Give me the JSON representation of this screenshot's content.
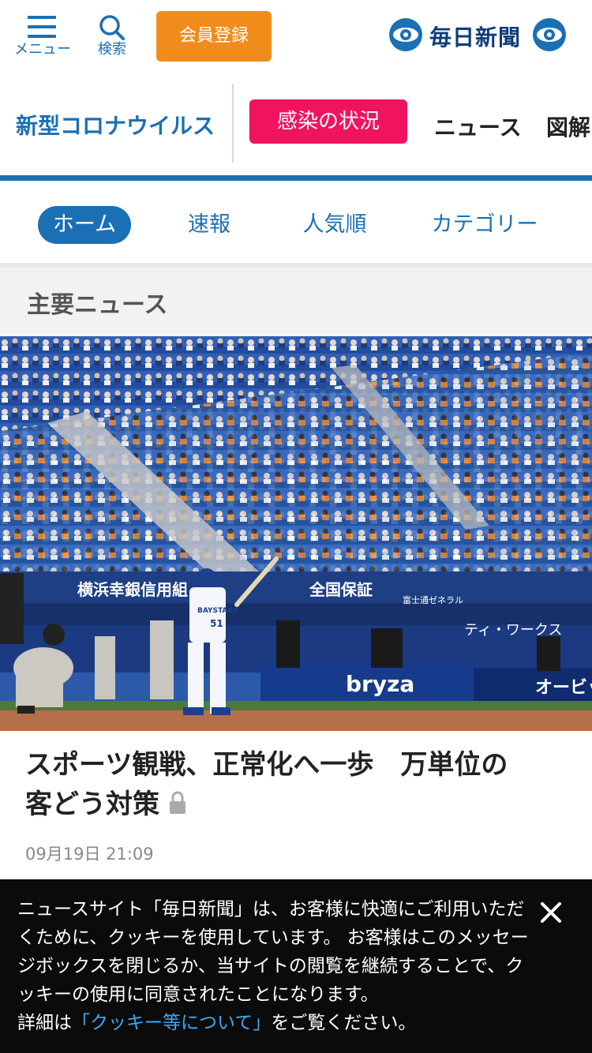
{
  "header": {
    "menu_label": "メニュー",
    "search_label": "検索",
    "register_label": "会員登録",
    "logo_text": "毎日新聞"
  },
  "corona": {
    "title": "新型コロナウイルス",
    "status_button": "感染の状況",
    "links": [
      "ニュース",
      "図解"
    ]
  },
  "tabs": [
    {
      "label": "ホーム",
      "active": true
    },
    {
      "label": "速報",
      "active": false
    },
    {
      "label": "人気順",
      "active": false
    },
    {
      "label": "カテゴリー",
      "active": false
    }
  ],
  "section": {
    "title": "主要ニュース"
  },
  "article": {
    "headline_line1": "スポーツ観戦、正常化へ一歩　万単位の",
    "headline_line2": "客どう対策",
    "date": "09月19日 21:09",
    "locked": true
  },
  "photo_signs": {
    "bank": "横浜幸銀信用組",
    "insurance": "全国保証",
    "bryza": "bryza",
    "tworks": "ティ・ワークス",
    "obic": "オービッ",
    "sponsor_small": "富士通ゼネラル",
    "uniform": "BAYSTARS",
    "number": "51"
  },
  "cookie": {
    "text_before": "ニュースサイト「毎日新聞」は、お客様に快適にご利用いただくために、クッキーを使用しています。 お客様はこのメッセージボックスを閉じるか、当サイトの閲覧を継続することで、クッキーの使用に同意されたことになります。",
    "text_details": "詳細は",
    "link_text": "「クッキー等について」",
    "text_after": "をご覧ください。"
  },
  "colors": {
    "brand_blue": "#1a6fb5",
    "register_orange": "#f08c1c",
    "infect_pink": "#f0135f",
    "logo_navy": "#0d3d7a",
    "cookie_bg": "#0b0b0b",
    "cookie_link": "#3fa9f5"
  },
  "icons": [
    "hamburger-menu-icon",
    "search-icon",
    "mainichi-eye-icon",
    "lock-icon",
    "close-icon"
  ]
}
